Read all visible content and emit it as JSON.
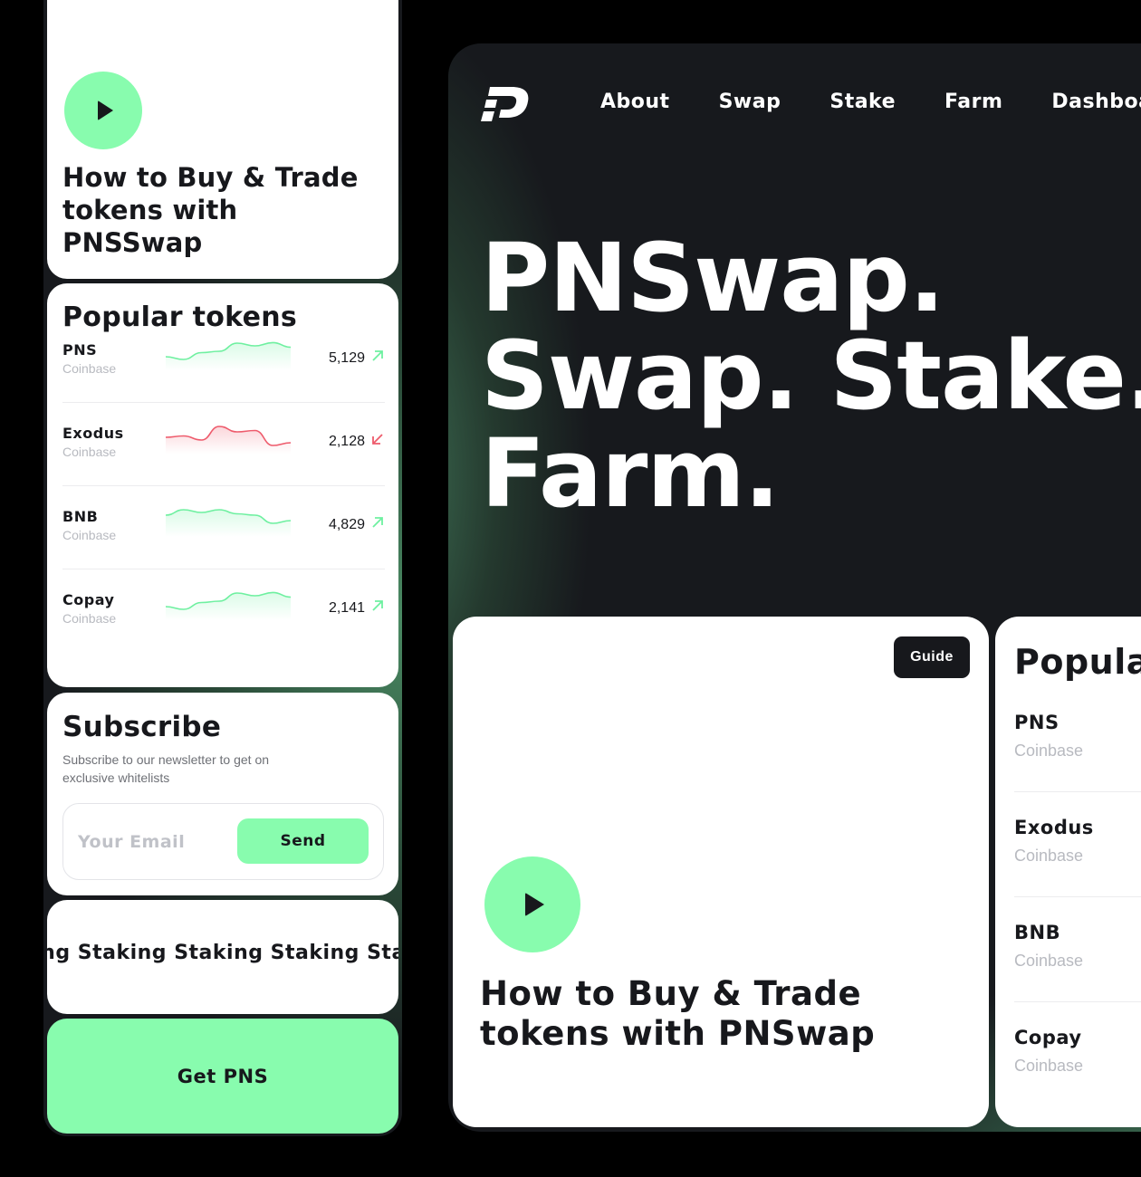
{
  "colors": {
    "accent": "#88fcae",
    "dark": "#17191d",
    "up": "#6ef0a0",
    "down": "#ee5b6c"
  },
  "mobile": {
    "hero": {
      "play_icon": "play-icon",
      "title": "How to Buy & Trade tokens with PNSSwap"
    },
    "popular": {
      "title": "Popular tokens",
      "tokens": [
        {
          "symbol": "PNS",
          "exchange": "Coinbase",
          "value": "5,129",
          "trend": "up",
          "spark": [
            3,
            2,
            4.5,
            5,
            8,
            7,
            8.2,
            6.5
          ]
        },
        {
          "symbol": "Exodus",
          "exchange": "Coinbase",
          "value": "2,128",
          "trend": "down",
          "spark": [
            4,
            4.5,
            3,
            8,
            6,
            6.5,
            1,
            2
          ]
        },
        {
          "symbol": "BNB",
          "exchange": "Coinbase",
          "value": "4,829",
          "trend": "up",
          "spark": [
            6,
            8,
            7,
            8,
            6.5,
            6,
            3,
            4
          ]
        },
        {
          "symbol": "Copay",
          "exchange": "Coinbase",
          "value": "2,141",
          "trend": "up",
          "spark": [
            3,
            2,
            4.5,
            5,
            8,
            7,
            8.2,
            6.5
          ]
        }
      ]
    },
    "subscribe": {
      "title": "Subscribe",
      "description": "Subscribe to our newsletter to get on exclusive whitelists",
      "email_placeholder": "Your Email",
      "email_value": "",
      "send_label": "Send"
    },
    "marquee": "king Staking Staking Staking Staking",
    "get_label": "Get PNS"
  },
  "desktop": {
    "logo_icon": "pnswap-logo-icon",
    "nav": [
      "About",
      "Swap",
      "Stake",
      "Farm",
      "Dashboard"
    ],
    "headline": [
      "PNSwap.",
      "Swap. Stake.",
      "Farm."
    ],
    "guide_card": {
      "badge": "Guide",
      "title": "How to Buy & Trade tokens with PNSwap"
    },
    "popular": {
      "title": "Popular tokens",
      "tokens": [
        {
          "symbol": "PNS",
          "exchange": "Coinbase"
        },
        {
          "symbol": "Exodus",
          "exchange": "Coinbase"
        },
        {
          "symbol": "BNB",
          "exchange": "Coinbase"
        },
        {
          "symbol": "Copay",
          "exchange": "Coinbase"
        }
      ]
    }
  }
}
